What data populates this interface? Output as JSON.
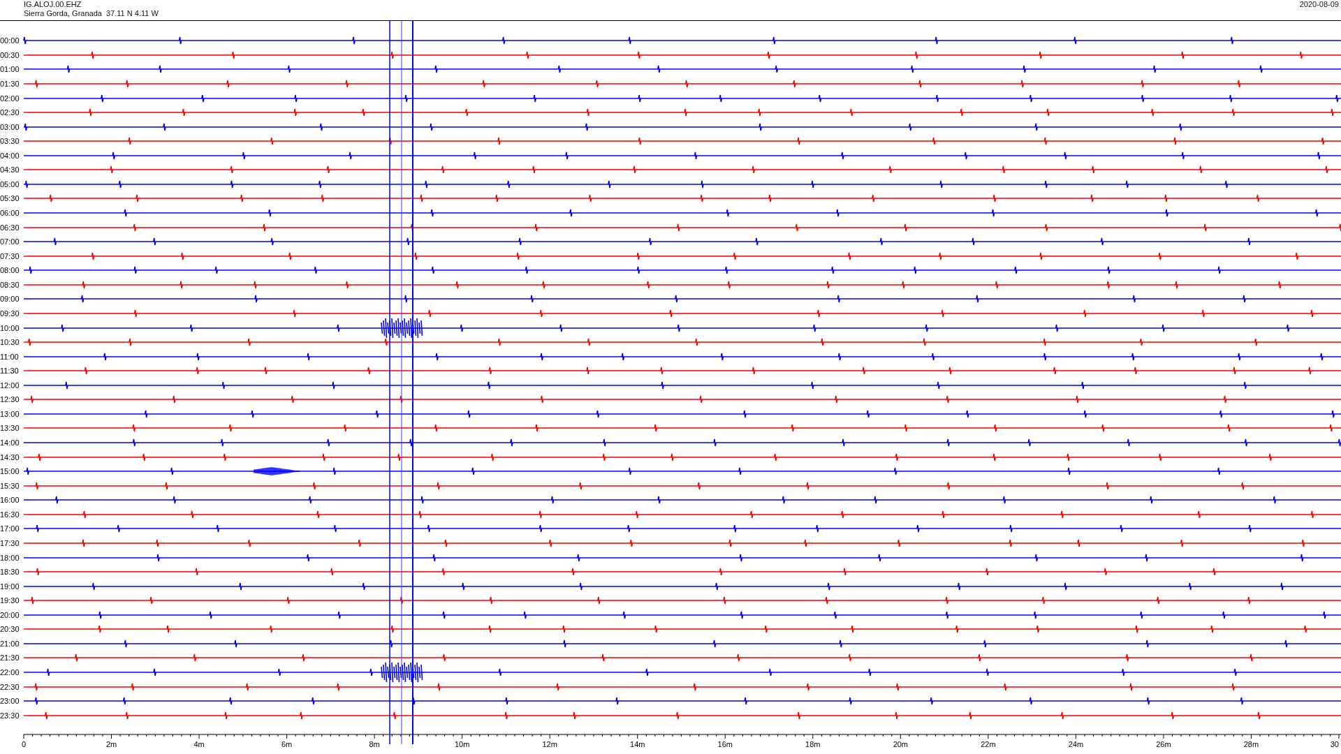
{
  "header": {
    "station": "IG.ALOJ.00.EHZ",
    "location": "Sierra Gorda, Granada  37.11 N 4.11 W",
    "date": "2020-08-09"
  },
  "rows": [
    {
      "label": "00:00",
      "color": "#0000ff"
    },
    {
      "label": "00:30",
      "color": "#ff0000"
    },
    {
      "label": "01:00",
      "color": "#0000ff"
    },
    {
      "label": "01:30",
      "color": "#ff0000"
    },
    {
      "label": "02:00",
      "color": "#0000ff"
    },
    {
      "label": "02:30",
      "color": "#ff0000"
    },
    {
      "label": "03:00",
      "color": "#0000ff"
    },
    {
      "label": "03:30",
      "color": "#ff0000"
    },
    {
      "label": "04:00",
      "color": "#0000ff"
    },
    {
      "label": "04:30",
      "color": "#ff0000"
    },
    {
      "label": "05:00",
      "color": "#0000ff"
    },
    {
      "label": "05:30",
      "color": "#ff0000"
    },
    {
      "label": "06:00",
      "color": "#0000ff"
    },
    {
      "label": "06:30",
      "color": "#ff0000"
    },
    {
      "label": "07:00",
      "color": "#0000ff"
    },
    {
      "label": "07:30",
      "color": "#ff0000"
    },
    {
      "label": "08:00",
      "color": "#0000ff"
    },
    {
      "label": "08:30",
      "color": "#ff0000"
    },
    {
      "label": "09:00",
      "color": "#0000ff"
    },
    {
      "label": "09:30",
      "color": "#ff0000"
    },
    {
      "label": "10:00",
      "color": "#0000ff"
    },
    {
      "label": "10:30",
      "color": "#ff0000"
    },
    {
      "label": "11:00",
      "color": "#0000ff"
    },
    {
      "label": "11:30",
      "color": "#ff0000"
    },
    {
      "label": "12:00",
      "color": "#0000ff"
    },
    {
      "label": "12:30",
      "color": "#ff0000"
    },
    {
      "label": "13:00",
      "color": "#0000ff"
    },
    {
      "label": "13:30",
      "color": "#ff0000"
    },
    {
      "label": "14:00",
      "color": "#0000ff"
    },
    {
      "label": "14:30",
      "color": "#ff0000"
    },
    {
      "label": "15:00",
      "color": "#0000ff"
    },
    {
      "label": "15:30",
      "color": "#ff0000"
    },
    {
      "label": "16:00",
      "color": "#0000ff"
    },
    {
      "label": "16:30",
      "color": "#ff0000"
    },
    {
      "label": "17:00",
      "color": "#0000ff"
    },
    {
      "label": "17:30",
      "color": "#ff0000"
    },
    {
      "label": "18:00",
      "color": "#0000ff"
    },
    {
      "label": "18:30",
      "color": "#ff0000"
    },
    {
      "label": "19:00",
      "color": "#0000ff"
    },
    {
      "label": "19:30",
      "color": "#ff0000"
    },
    {
      "label": "20:00",
      "color": "#0000ff"
    },
    {
      "label": "20:30",
      "color": "#ff0000"
    },
    {
      "label": "21:00",
      "color": "#0000ff"
    },
    {
      "label": "21:30",
      "color": "#ff0000"
    },
    {
      "label": "22:00",
      "color": "#0000ff"
    },
    {
      "label": "22:30",
      "color": "#ff0000"
    },
    {
      "label": "23:00",
      "color": "#0000ff"
    },
    {
      "label": "23:30",
      "color": "#ff0000"
    }
  ],
  "axis": {
    "labels": [
      "0",
      "2m",
      "4m",
      "6m",
      "8m",
      "10m",
      "12m",
      "14m",
      "16m",
      "18m",
      "20m",
      "22m",
      "24m",
      "26m",
      "28m",
      "30"
    ]
  }
}
